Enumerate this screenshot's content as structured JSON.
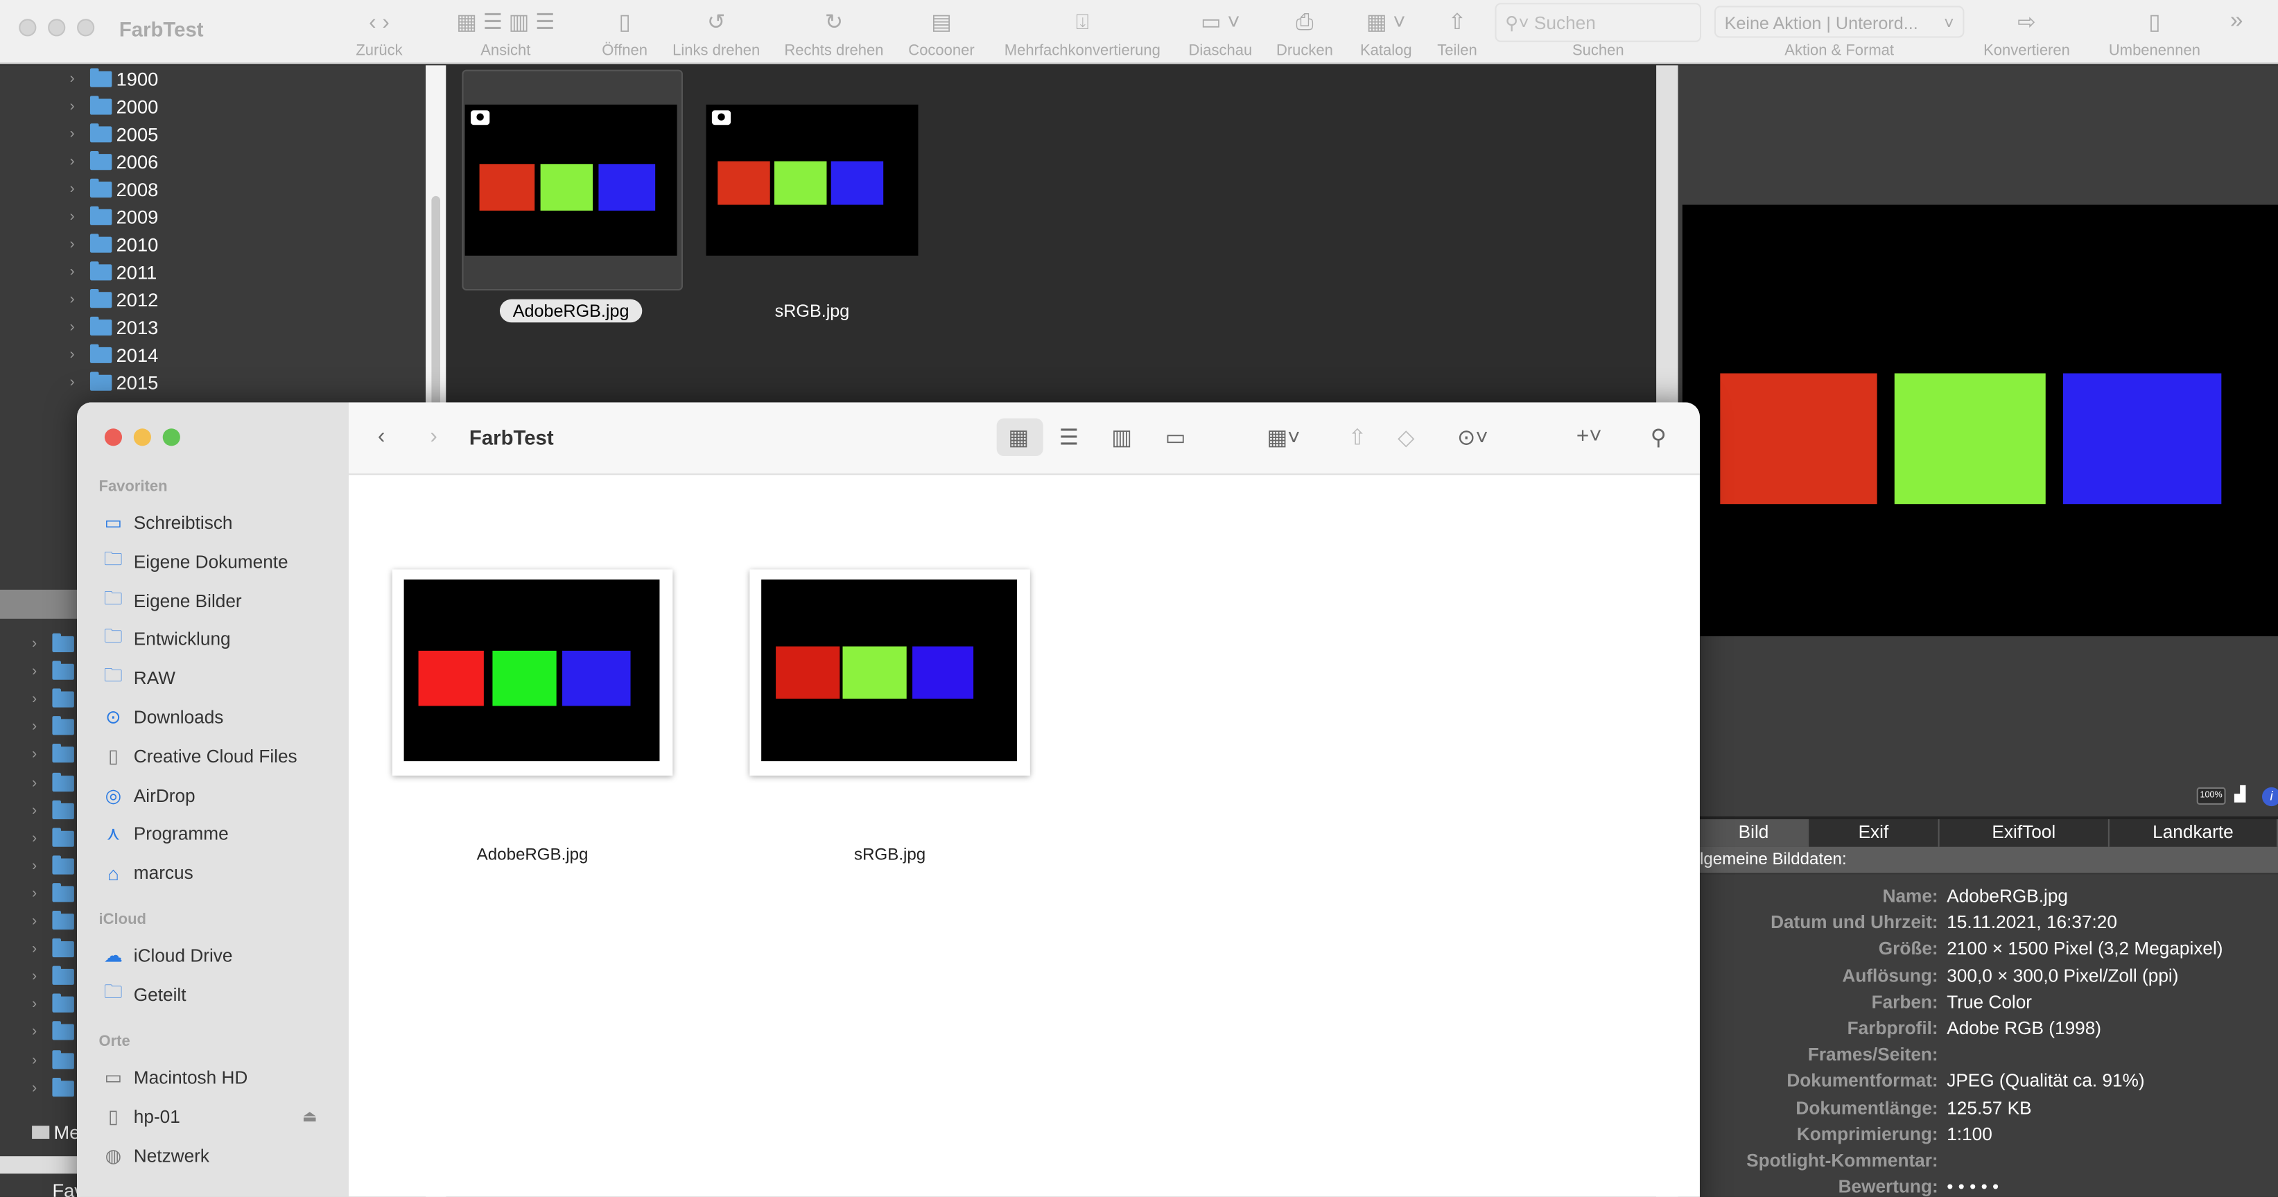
{
  "app": {
    "title": "FarbTest",
    "toolbar": [
      {
        "label": "Zurück",
        "icon": "chevron-left-right-icon"
      },
      {
        "label": "Ansicht",
        "icon": "view-icons"
      },
      {
        "label": "Öffnen",
        "icon": "open-icon"
      },
      {
        "label": "Links drehen",
        "icon": "rotate-left-icon"
      },
      {
        "label": "Rechts drehen",
        "icon": "rotate-right-icon"
      },
      {
        "label": "Cocooner",
        "icon": "cocooner-icon"
      },
      {
        "label": "Mehrfachkonvertierung",
        "icon": "batch-convert-icon"
      },
      {
        "label": "Diaschau",
        "icon": "slideshow-icon"
      },
      {
        "label": "Drucken",
        "icon": "print-icon"
      },
      {
        "label": "Katalog",
        "icon": "catalog-icon"
      },
      {
        "label": "Teilen",
        "icon": "share-icon"
      },
      {
        "label": "Suchen",
        "icon": "search-icon"
      },
      {
        "label": "Aktion & Format",
        "icon": "action-icon"
      },
      {
        "label": "Konvertieren",
        "icon": "convert-icon"
      },
      {
        "label": "Umbenennen",
        "icon": "rename-icon"
      }
    ],
    "search_placeholder": "Suchen",
    "action_select": "Keine Aktion | Unterord...",
    "tree": [
      "1900",
      "2000",
      "2005",
      "2006",
      "2008",
      "2009",
      "2010",
      "2011",
      "2012",
      "2013",
      "2014",
      "2015"
    ],
    "tree_bottom": [
      "Me",
      "Fav"
    ],
    "thumbnails": [
      {
        "name": "AdobeRGB.jpg",
        "selected": true
      },
      {
        "name": "sRGB.jpg",
        "selected": false
      }
    ],
    "preview_buttons": {
      "zoom": "100%"
    },
    "info_tabs": [
      "Bild",
      "Exif",
      "ExifTool",
      "Landkarte"
    ],
    "info_header": "lgemeine Bilddaten:",
    "info": [
      {
        "label": "Name:",
        "value": "AdobeRGB.jpg"
      },
      {
        "label": "Datum und Uhrzeit:",
        "value": "15.11.2021, 16:37:20"
      },
      {
        "label": "Größe:",
        "value": "2100 × 1500 Pixel (3,2 Megapixel)"
      },
      {
        "label": "Auflösung:",
        "value": "300,0 × 300,0 Pixel/Zoll (ppi)"
      },
      {
        "label": "Farben:",
        "value": "True Color"
      },
      {
        "label": "Farbprofil:",
        "value": "Adobe RGB (1998)"
      },
      {
        "label": "Frames/Seiten:",
        "value": ""
      },
      {
        "label": "Dokumentformat:",
        "value": "JPEG (Qualität ca. 91%)"
      },
      {
        "label": "Dokumentlänge:",
        "value": "125.57 KB"
      },
      {
        "label": "Komprimierung:",
        "value": "1:100"
      },
      {
        "label": "Spotlight-Kommentar:",
        "value": ""
      },
      {
        "label": "Bewertung:",
        "value": "•  •  •  •  •"
      }
    ]
  },
  "finder": {
    "title": "FarbTest",
    "sections": [
      {
        "title": "Favoriten",
        "items": [
          {
            "label": "Schreibtisch",
            "icon": "desktop-icon"
          },
          {
            "label": "Eigene Dokumente",
            "icon": "folder-icon"
          },
          {
            "label": "Eigene Bilder",
            "icon": "folder-icon"
          },
          {
            "label": "Entwicklung",
            "icon": "folder-icon"
          },
          {
            "label": "RAW",
            "icon": "folder-icon"
          },
          {
            "label": "Downloads",
            "icon": "download-icon"
          },
          {
            "label": "Creative Cloud Files",
            "icon": "document-icon"
          },
          {
            "label": "AirDrop",
            "icon": "airdrop-icon"
          },
          {
            "label": "Programme",
            "icon": "apps-icon"
          },
          {
            "label": "marcus",
            "icon": "home-icon"
          }
        ]
      },
      {
        "title": "iCloud",
        "items": [
          {
            "label": "iCloud Drive",
            "icon": "cloud-icon"
          },
          {
            "label": "Geteilt",
            "icon": "shared-folder-icon"
          }
        ]
      },
      {
        "title": "Orte",
        "items": [
          {
            "label": "Macintosh HD",
            "icon": "disk-icon"
          },
          {
            "label": "hp-01",
            "icon": "document-icon"
          },
          {
            "label": "Netzwerk",
            "icon": "globe-icon"
          }
        ]
      }
    ],
    "files": [
      {
        "name": "AdobeRGB.jpg",
        "colors": [
          "#f41e1e",
          "#1fef1f",
          "#2a1ef0"
        ]
      },
      {
        "name": "sRGB.jpg",
        "colors": [
          "#d61e12",
          "#8cf23e",
          "#2c12ef"
        ]
      }
    ]
  },
  "colors": {
    "adobe_xn": [
      "#d9321a",
      "#8af03e",
      "#2a22f2"
    ]
  }
}
